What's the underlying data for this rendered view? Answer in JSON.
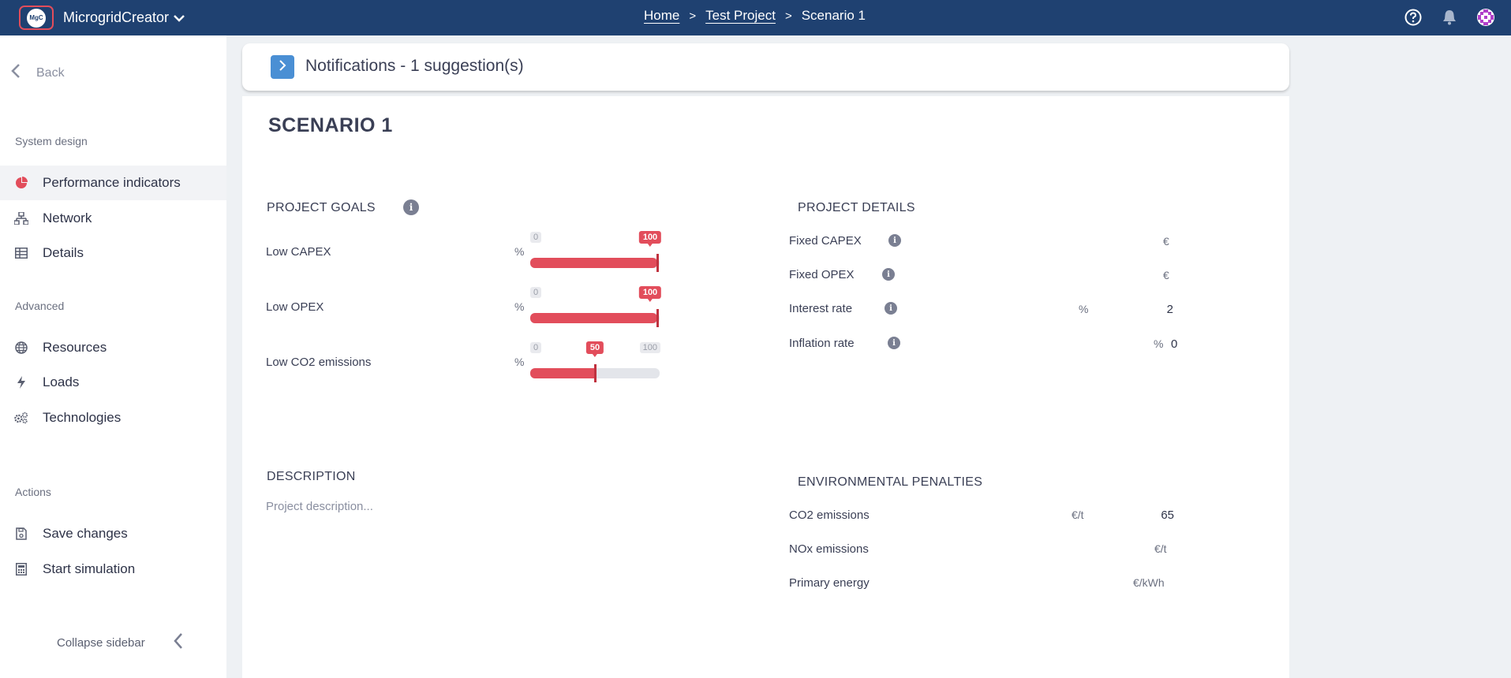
{
  "app": {
    "name": "MicrogridCreator",
    "logo_text": "MgC"
  },
  "breadcrumb": {
    "home": "Home",
    "project": "Test Project",
    "current": "Scenario 1"
  },
  "topbar_icons": [
    "help-icon",
    "bell-icon",
    "avatar-icon"
  ],
  "sidebar": {
    "back": "Back",
    "sections": {
      "system_design": "System design",
      "advanced": "Advanced",
      "actions": "Actions"
    },
    "items": [
      {
        "label": "Performance indicators",
        "icon": "pie-chart-icon",
        "active": true
      },
      {
        "label": "Network",
        "icon": "network-icon"
      },
      {
        "label": "Details",
        "icon": "table-icon"
      },
      {
        "label": "Resources",
        "icon": "globe-icon"
      },
      {
        "label": "Loads",
        "icon": "bolt-icon"
      },
      {
        "label": "Technologies",
        "icon": "gears-icon"
      },
      {
        "label": "Save changes",
        "icon": "save-icon"
      },
      {
        "label": "Start simulation",
        "icon": "calculator-icon"
      }
    ],
    "collapse": "Collapse sidebar"
  },
  "notifications": {
    "title": "Notifications - 1 suggestion(s)"
  },
  "scenario": {
    "title": "SCENARIO 1"
  },
  "project_goals": {
    "title": "PROJECT GOALS",
    "unit": "%",
    "min_label": "0",
    "max_label": "100",
    "goals": [
      {
        "label": "Low CAPEX",
        "value": 100
      },
      {
        "label": "Low OPEX",
        "value": 100
      },
      {
        "label": "Low CO2 emissions",
        "value": 50
      }
    ]
  },
  "project_details": {
    "title": "PROJECT DETAILS",
    "rows": [
      {
        "label": "Fixed CAPEX",
        "unit": "€",
        "value": ""
      },
      {
        "label": "Fixed OPEX",
        "unit": "€",
        "value": ""
      },
      {
        "label": "Interest rate",
        "unit": "%",
        "value": "2"
      },
      {
        "label": "Inflation rate",
        "unit": "%",
        "value": "0"
      }
    ]
  },
  "description": {
    "title": "DESCRIPTION",
    "placeholder": "Project description..."
  },
  "environmental_penalties": {
    "title": "ENVIRONMENTAL PENALTIES",
    "rows": [
      {
        "label": "CO2 emissions",
        "unit": "€/t",
        "value": "65"
      },
      {
        "label": "NOx emissions",
        "unit": "€/t",
        "value": ""
      },
      {
        "label": "Primary energy",
        "unit": "€/kWh",
        "value": ""
      }
    ]
  },
  "colors": {
    "topbar": "#1f4171",
    "accent": "#e24d5b",
    "notif_button": "#4a8fd4"
  }
}
